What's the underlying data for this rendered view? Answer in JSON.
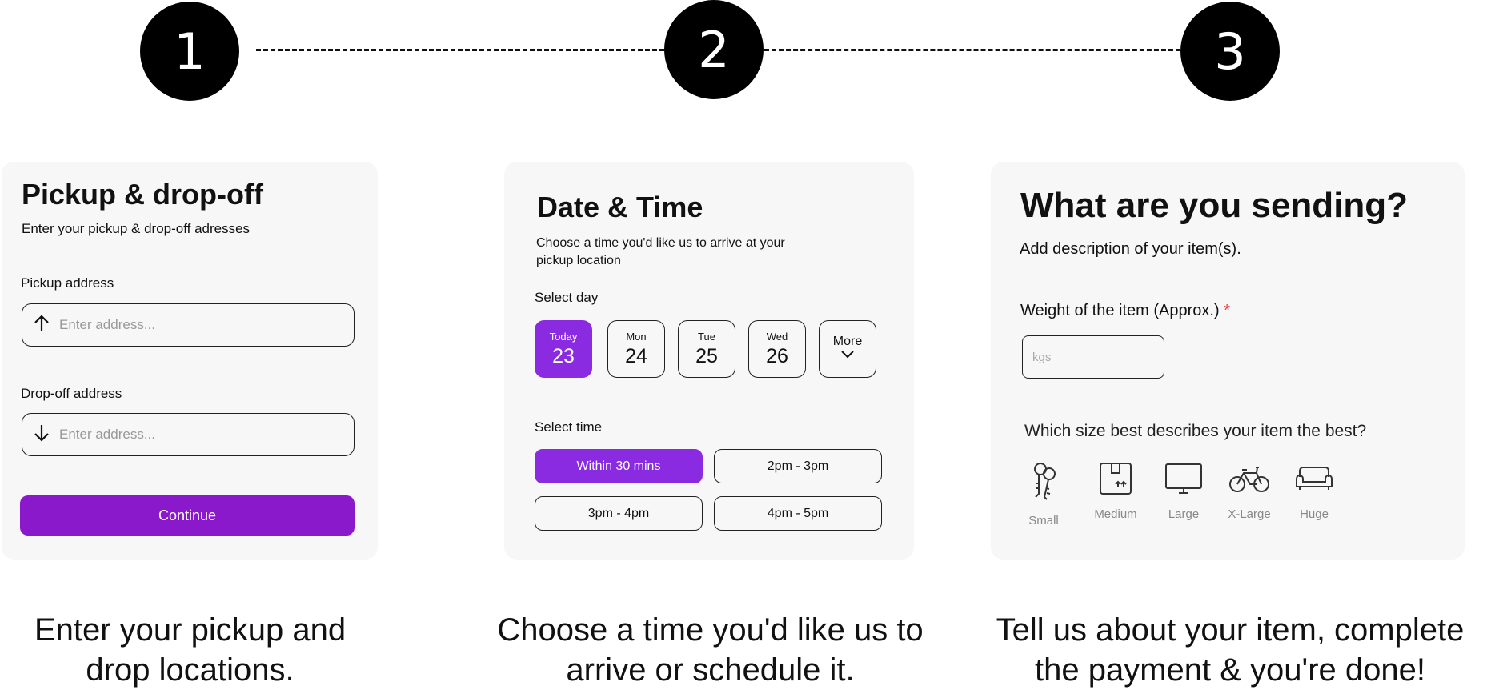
{
  "steps": [
    "1",
    "2",
    "3"
  ],
  "card1": {
    "title": "Pickup & drop-off",
    "subtitle": "Enter your pickup & drop-off adresses",
    "pickup_label": "Pickup address",
    "pickup_placeholder": "Enter address...",
    "dropoff_label": "Drop-off address",
    "dropoff_placeholder": "Enter address...",
    "continue_label": "Continue"
  },
  "card2": {
    "title": "Date & Time",
    "subtitle": "Choose a time you'd like us to arrive at your pickup location",
    "select_day_label": "Select day",
    "days": [
      {
        "name": "Today",
        "date": "23"
      },
      {
        "name": "Mon",
        "date": "24"
      },
      {
        "name": "Tue",
        "date": "25"
      },
      {
        "name": "Wed",
        "date": "26"
      }
    ],
    "more_label": "More",
    "select_time_label": "Select time",
    "times": [
      "Within 30 mins",
      "2pm - 3pm",
      "3pm - 4pm",
      "4pm - 5pm"
    ]
  },
  "card3": {
    "title": "What are you sending?",
    "subtitle": "Add description of your item(s).",
    "weight_label": "Weight of the item (Approx.)",
    "required_mark": "*",
    "weight_placeholder": "kgs",
    "size_question": "Which size best describes your item the best?",
    "sizes": [
      {
        "label": "Small",
        "icon": "keys-icon"
      },
      {
        "label": "Medium",
        "icon": "box-icon"
      },
      {
        "label": "Large",
        "icon": "tv-icon"
      },
      {
        "label": "X-Large",
        "icon": "bicycle-icon"
      },
      {
        "label": "Huge",
        "icon": "sofa-icon"
      }
    ]
  },
  "captions": [
    "Enter your pickup and drop locations.",
    "Choose a time you'd like us to arrive or schedule it.",
    "Tell us about your item, complete the payment & you're done!"
  ],
  "colors": {
    "accent": "#8a19cc",
    "accent_light": "#8a2be2",
    "required": "#e53935"
  }
}
